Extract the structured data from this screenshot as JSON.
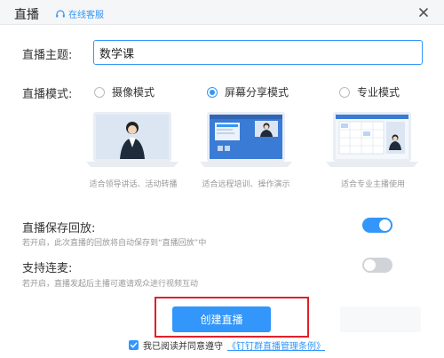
{
  "dialog": {
    "title": "直播",
    "service_link": "在线客服"
  },
  "topic": {
    "label": "直播主题:",
    "value": "数学课"
  },
  "mode": {
    "label": "直播模式:",
    "options": [
      {
        "label": "摄像模式",
        "caption": "适合领导讲话、活动转播",
        "selected": false
      },
      {
        "label": "屏幕分享模式",
        "caption": "适合远程培训、操作演示",
        "selected": true
      },
      {
        "label": "专业模式",
        "caption": "适合专业主播使用",
        "selected": false
      }
    ]
  },
  "playback": {
    "label": "直播保存回放:",
    "hint": "若开启，此次直播的回放将自动保存到“直播回放”中",
    "enabled": true
  },
  "co_host": {
    "label": "支持连麦:",
    "hint": "若开启，直播发起后主播可邀请观众进行视频互动",
    "enabled": false
  },
  "create_button": "创建直播",
  "agreement": {
    "prefix": "我已阅读并同意遵守",
    "link": "《钉钉群直播管理条例》",
    "checked": true
  },
  "colors": {
    "accent": "#3296fa",
    "highlight_frame": "#e0202a"
  }
}
